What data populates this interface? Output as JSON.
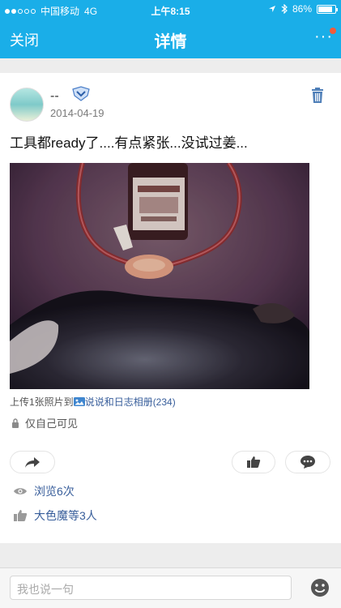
{
  "status_bar": {
    "carrier": "中国移动",
    "network": "4G",
    "time": "上午8:15",
    "battery": "86%",
    "battery_level": 0.86
  },
  "nav": {
    "close_label": "关闭",
    "title": "详情",
    "more_label": "···"
  },
  "post": {
    "username": "--",
    "date": "2014-04-19",
    "text": "工具都ready了....有点紧张...没试过姜...",
    "upload_prefix": "上传1张照片到",
    "album": "说说和日志相册(234)",
    "privacy": "仅自己可见"
  },
  "stats": {
    "views": "浏览6次",
    "likes": "大色魔等3人"
  },
  "comment": {
    "placeholder": "我也说一句"
  },
  "colors": {
    "brand": "#1aaee8",
    "link": "#385e9b"
  },
  "icons": [
    "signal-dots-icon",
    "location-arrow-icon",
    "bluetooth-icon",
    "battery-icon",
    "more-icon",
    "vip-badge-icon",
    "trash-icon",
    "album-icon",
    "lock-icon",
    "share-icon",
    "thumb-up-icon",
    "comment-bubble-icon",
    "eye-icon",
    "emoji-icon"
  ]
}
